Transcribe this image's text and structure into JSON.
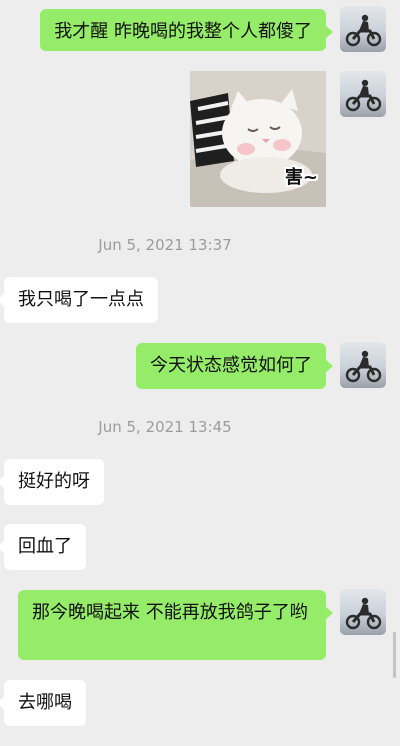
{
  "messages": [
    {
      "sender": "me",
      "text": "我才醒 昨晚喝的我整个人都傻了"
    },
    {
      "sender": "me",
      "type": "sticker",
      "caption": "害~"
    },
    {
      "sender": "system",
      "text": "Jun 5, 2021 13:37"
    },
    {
      "sender": "them",
      "text": "我只喝了一点点"
    },
    {
      "sender": "me",
      "text": "今天状态感觉如何了"
    },
    {
      "sender": "system",
      "text": "Jun 5, 2021 13:45"
    },
    {
      "sender": "them",
      "text": "挺好的呀"
    },
    {
      "sender": "them",
      "text": "回血了"
    },
    {
      "sender": "me",
      "text": "那今晚喝起来 不能再放我鸽子了哟"
    },
    {
      "sender": "them",
      "text": "去哪喝"
    }
  ],
  "colors": {
    "background": "#ededed",
    "my_bubble": "#95ec69",
    "their_bubble": "#ffffff",
    "timestamp": "#9c9c9c"
  },
  "icons": {
    "avatar": "motorcycle-rider-avatar",
    "sticker": "white-cat-sticker"
  }
}
